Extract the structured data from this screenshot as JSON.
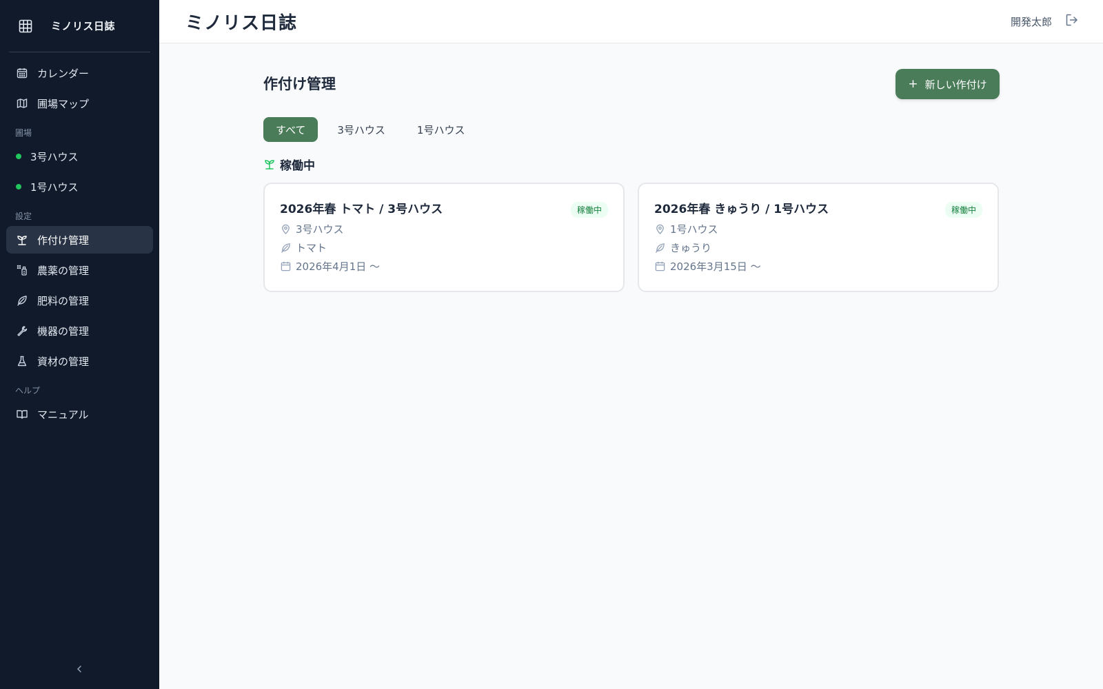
{
  "app": {
    "name": "ミノリス日誌"
  },
  "sidebar": {
    "nav": [
      {
        "label": "カレンダー",
        "icon": "calendar-icon"
      },
      {
        "label": "圃場マップ",
        "icon": "map-icon"
      }
    ],
    "fields_label": "圃場",
    "fields": [
      {
        "label": "3号ハウス",
        "status_color": "#22c55e"
      },
      {
        "label": "1号ハウス",
        "status_color": "#22c55e"
      }
    ],
    "settings_label": "設定",
    "settings": [
      {
        "label": "作付け管理",
        "icon": "sprout-icon",
        "active": true
      },
      {
        "label": "農薬の管理",
        "icon": "spray-icon"
      },
      {
        "label": "肥料の管理",
        "icon": "leaf-icon"
      },
      {
        "label": "機器の管理",
        "icon": "wrench-icon"
      },
      {
        "label": "資材の管理",
        "icon": "flask-icon"
      }
    ],
    "help_label": "ヘルプ",
    "help": [
      {
        "label": "マニュアル",
        "icon": "book-icon"
      }
    ]
  },
  "header": {
    "title": "ミノリス日誌",
    "user_name": "開発太郎"
  },
  "main": {
    "title": "作付け管理",
    "new_button": "新しい作付け",
    "tabs": [
      {
        "label": "すべて",
        "active": true
      },
      {
        "label": "3号ハウス"
      },
      {
        "label": "1号ハウス"
      }
    ],
    "group_title": "稼働中",
    "cards": [
      {
        "title": "2026年春 トマト / 3号ハウス",
        "badge": "稼働中",
        "field": "3号ハウス",
        "crop": "トマト",
        "date": "2026年4月1日 〜"
      },
      {
        "title": "2026年春 きゅうり / 1号ハウス",
        "badge": "稼働中",
        "field": "1号ハウス",
        "crop": "きゅうり",
        "date": "2026年3月15日 〜"
      }
    ]
  },
  "colors": {
    "sidebar_bg": "#111a2b",
    "accent": "#4a7c59",
    "status_green": "#22c55e"
  }
}
